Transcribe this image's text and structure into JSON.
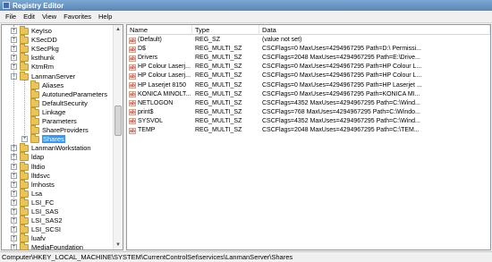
{
  "window": {
    "title": "Registry Editor"
  },
  "menu": [
    "File",
    "Edit",
    "View",
    "Favorites",
    "Help"
  ],
  "tree": {
    "items": [
      {
        "label": "KeyIso",
        "level": 1,
        "expander": "+"
      },
      {
        "label": "KSecDD",
        "level": 1,
        "expander": "+"
      },
      {
        "label": "KSecPkg",
        "level": 1,
        "expander": "+"
      },
      {
        "label": "ksthunk",
        "level": 1,
        "expander": "+"
      },
      {
        "label": "KtmRm",
        "level": 1,
        "expander": "+"
      },
      {
        "label": "LanmanServer",
        "level": 1,
        "expander": "−"
      },
      {
        "label": "Aliases",
        "level": 2,
        "expander": ""
      },
      {
        "label": "AutotunedParameters",
        "level": 2,
        "expander": ""
      },
      {
        "label": "DefaultSecurity",
        "level": 2,
        "expander": ""
      },
      {
        "label": "Linkage",
        "level": 2,
        "expander": ""
      },
      {
        "label": "Parameters",
        "level": 2,
        "expander": ""
      },
      {
        "label": "ShareProviders",
        "level": 2,
        "expander": ""
      },
      {
        "label": "Shares",
        "level": 2,
        "expander": "+",
        "selected": true
      },
      {
        "label": "LanmanWorkstation",
        "level": 1,
        "expander": "+"
      },
      {
        "label": "ldap",
        "level": 1,
        "expander": "+"
      },
      {
        "label": "lltdio",
        "level": 1,
        "expander": "+"
      },
      {
        "label": "lltdsvc",
        "level": 1,
        "expander": "+"
      },
      {
        "label": "lmhosts",
        "level": 1,
        "expander": "+"
      },
      {
        "label": "Lsa",
        "level": 1,
        "expander": "+"
      },
      {
        "label": "LSI_FC",
        "level": 1,
        "expander": "+"
      },
      {
        "label": "LSI_SAS",
        "level": 1,
        "expander": "+"
      },
      {
        "label": "LSI_SAS2",
        "level": 1,
        "expander": "+"
      },
      {
        "label": "LSI_SCSI",
        "level": 1,
        "expander": "+"
      },
      {
        "label": "luafv",
        "level": 1,
        "expander": "+"
      },
      {
        "label": "MediaFoundation",
        "level": 1,
        "expander": "+"
      }
    ]
  },
  "list": {
    "columns": [
      "Name",
      "Type",
      "Data"
    ],
    "rows": [
      {
        "name": "(Default)",
        "type": "REG_SZ",
        "data": "(value not set)",
        "icon": "ab"
      },
      {
        "name": "D$",
        "type": "REG_MULTI_SZ",
        "data": "CSCFlags=0 MaxUses=4294967295 Path=D:\\ Permissi...",
        "icon": "ab"
      },
      {
        "name": "Drivers",
        "type": "REG_MULTI_SZ",
        "data": "CSCFlags=2048 MaxUses=4294967295 Path=E:\\Drive...",
        "icon": "ab"
      },
      {
        "name": "HP Colour Laserj...",
        "type": "REG_MULTI_SZ",
        "data": "CSCFlags=0 MaxUses=4294967295 Path=HP Colour L...",
        "icon": "ab"
      },
      {
        "name": "HP Colour Laserj...",
        "type": "REG_MULTI_SZ",
        "data": "CSCFlags=0 MaxUses=4294967295 Path=HP Colour L...",
        "icon": "ab"
      },
      {
        "name": "HP Laserjet 8150",
        "type": "REG_MULTI_SZ",
        "data": "CSCFlags=0 MaxUses=4294967295 Path=HP Laserjet ...",
        "icon": "ab"
      },
      {
        "name": "KONICA MINOLT...",
        "type": "REG_MULTI_SZ",
        "data": "CSCFlags=0 MaxUses=4294967295 Path=KONICA MI...",
        "icon": "ab"
      },
      {
        "name": "NETLOGON",
        "type": "REG_MULTI_SZ",
        "data": "CSCFlags=4352 MaxUses=4294967295 Path=C:\\Wind...",
        "icon": "ab"
      },
      {
        "name": "print$",
        "type": "REG_MULTI_SZ",
        "data": "CSCFlags=768 MaxUses=4294967295 Path=C:\\Windo...",
        "icon": "ab"
      },
      {
        "name": "SYSVOL",
        "type": "REG_MULTI_SZ",
        "data": "CSCFlags=4352 MaxUses=4294967295 Path=C:\\Wind...",
        "icon": "ab"
      },
      {
        "name": "TEMP",
        "type": "REG_MULTI_SZ",
        "data": "CSCFlags=2048 MaxUses=4294967295 Path=C:\\TEM...",
        "icon": "ab"
      }
    ]
  },
  "status": {
    "path": "Computer\\HKEY_LOCAL_MACHINE\\SYSTEM\\CurrentControlSet\\services\\LanmanServer\\Shares"
  }
}
